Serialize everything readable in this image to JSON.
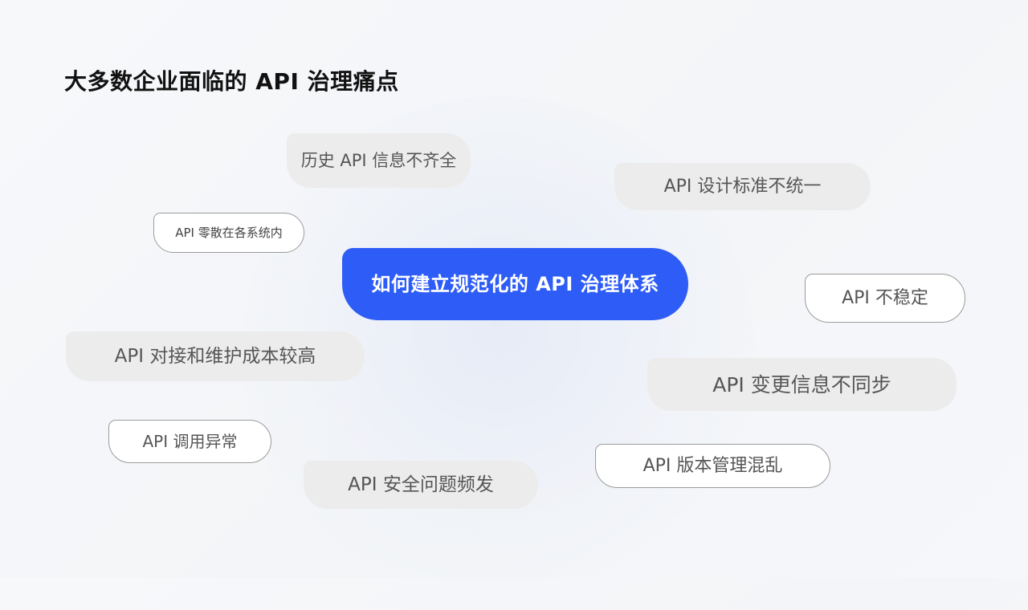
{
  "page": {
    "title": "大多数企业面临的 API 治理痛点"
  },
  "center": {
    "label": "如何建立规范化的 API 治理体系",
    "color": "#2d5cf6"
  },
  "pain_points": [
    "历史 API 信息不齐全",
    "API 设计标准不统一",
    "API 零散在各系统内",
    "API 不稳定",
    "API 对接和维护成本较高",
    "API 变更信息不同步",
    "API 调用异常",
    "API 版本管理混乱",
    "API 安全问题频发"
  ]
}
